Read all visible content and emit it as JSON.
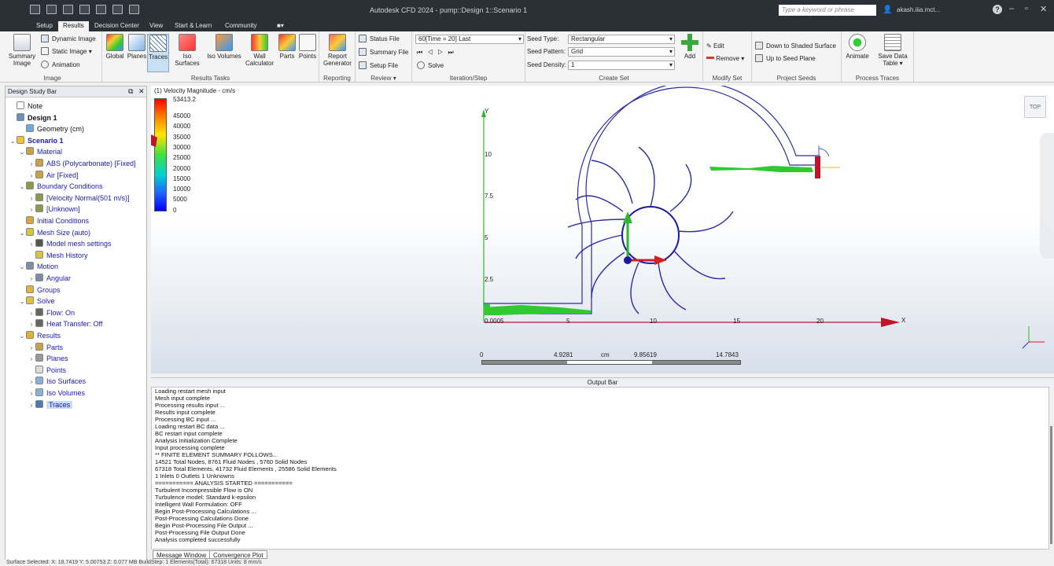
{
  "app": {
    "title": "Autodesk CFD 2024 - pump::Design 1::Scenario 1",
    "search_placeholder": "Type a keyword or phrase",
    "user": "akash.iiia.mct...",
    "help": "?"
  },
  "tabs": [
    "Setup",
    "Results",
    "Decision Center",
    "View",
    "Start & Learn",
    "Community"
  ],
  "ribbon": {
    "image": {
      "summary": "Summary Image",
      "dynamic": "Dynamic Image",
      "static": "Static Image",
      "animation": "Animation",
      "label": "Image"
    },
    "results_tasks": {
      "global": "Global",
      "planes": "Planes",
      "traces": "Traces",
      "iso_surfaces": "Iso Surfaces",
      "iso_volumes": "Iso Volumes",
      "wall_calculator": "Wall Calculator",
      "parts": "Parts",
      "points": "Points",
      "label": "Results Tasks"
    },
    "reporting": {
      "report": "Report Generator",
      "label": "Reporting"
    },
    "review": {
      "status": "Status File",
      "summary": "Summary File",
      "setup": "Setup File",
      "label": "Review"
    },
    "iteration": {
      "value": "60[Time = 20] Last",
      "solve": "Solve",
      "label": "Iteration/Step"
    },
    "create_set": {
      "seed_type_label": "Seed Type:",
      "seed_type": "Rectangular",
      "seed_pattern_label": "Seed Pattern:",
      "seed_pattern": "Grid",
      "seed_density_label": "Seed Density:",
      "seed_density": "1",
      "add": "Add",
      "label": "Create Set"
    },
    "modify_set": {
      "edit": "Edit",
      "remove": "Remove",
      "label": "Modify Set"
    },
    "project_seeds": {
      "down": "Down to Shaded Surface",
      "up": "Up to Seed Plane",
      "label": "Project Seeds"
    },
    "process_traces": {
      "animate": "Animate",
      "save": "Save Data Table",
      "label": "Process Traces"
    }
  },
  "design_bar": {
    "title": "Design Study Bar",
    "items": [
      {
        "label": "Note",
        "indent": 0,
        "arrow": "",
        "style": "dark",
        "color": "#ffffff"
      },
      {
        "label": "Design 1",
        "indent": 0,
        "arrow": "",
        "style": "dark bold",
        "color": "#6c8fbf"
      },
      {
        "label": "Geometry (cm)",
        "indent": 1,
        "arrow": "",
        "style": "dark",
        "color": "#6fa8dc"
      },
      {
        "label": "Scenario 1",
        "indent": 0,
        "arrow": "⌄",
        "style": "bold",
        "color": "#f1c232"
      },
      {
        "label": "Material",
        "indent": 1,
        "arrow": "⌄",
        "style": "",
        "color": "#c8a24a"
      },
      {
        "label": "ABS (Polycarbonate) [Fixed]",
        "indent": 2,
        "arrow": "›",
        "style": "",
        "color": "#c8a24a"
      },
      {
        "label": "Air [Fixed]",
        "indent": 2,
        "arrow": "›",
        "style": "",
        "color": "#c8a24a"
      },
      {
        "label": "Boundary Conditions",
        "indent": 1,
        "arrow": "⌄",
        "style": "",
        "color": "#8a9a4a"
      },
      {
        "label": "[Velocity Normal(501 m/s)]",
        "indent": 2,
        "arrow": "›",
        "style": "",
        "color": "#8a9a4a"
      },
      {
        "label": "[Unknown]",
        "indent": 2,
        "arrow": "›",
        "style": "",
        "color": "#8a9a4a"
      },
      {
        "label": "Initial Conditions",
        "indent": 1,
        "arrow": "",
        "style": "",
        "color": "#d9a441"
      },
      {
        "label": "Mesh Size (auto)",
        "indent": 1,
        "arrow": "⌄",
        "style": "",
        "color": "#d9c441"
      },
      {
        "label": "Model mesh settings",
        "indent": 2,
        "arrow": "›",
        "style": "",
        "color": "#555555"
      },
      {
        "label": "Mesh History",
        "indent": 2,
        "arrow": "",
        "style": "",
        "color": "#d9c441"
      },
      {
        "label": "Motion",
        "indent": 1,
        "arrow": "⌄",
        "style": "",
        "color": "#7a8ea8"
      },
      {
        "label": "Angular",
        "indent": 2,
        "arrow": "›",
        "style": "",
        "color": "#7a8ea8"
      },
      {
        "label": "Groups",
        "indent": 1,
        "arrow": "",
        "style": "",
        "color": "#e0b040"
      },
      {
        "label": "Solve",
        "indent": 1,
        "arrow": "⌄",
        "style": "",
        "color": "#e0c040"
      },
      {
        "label": "Flow: On",
        "indent": 2,
        "arrow": "›",
        "style": "",
        "color": "#666666"
      },
      {
        "label": "Heat Transfer: Off",
        "indent": 2,
        "arrow": "›",
        "style": "",
        "color": "#666666"
      },
      {
        "label": "Results",
        "indent": 1,
        "arrow": "⌄",
        "style": "",
        "color": "#e0b030"
      },
      {
        "label": "Parts",
        "indent": 2,
        "arrow": "›",
        "style": "",
        "color": "#c8a24a"
      },
      {
        "label": "Planes",
        "indent": 2,
        "arrow": "›",
        "style": "",
        "color": "#999999"
      },
      {
        "label": "Points",
        "indent": 2,
        "arrow": "",
        "style": "",
        "color": "#dddddd"
      },
      {
        "label": "Iso Surfaces",
        "indent": 2,
        "arrow": "›",
        "style": "",
        "color": "#8ab0d8"
      },
      {
        "label": "Iso Volumes",
        "indent": 2,
        "arrow": "›",
        "style": "",
        "color": "#8ab0d8"
      },
      {
        "label": "Traces",
        "indent": 2,
        "arrow": "›",
        "style": "sel",
        "color": "#4a7ab0"
      }
    ]
  },
  "viewport": {
    "legend_title": "(1) Velocity Magnitude - cm/s",
    "legend_ticks": [
      "53413.2",
      "45000",
      "40000",
      "35000",
      "30000",
      "25000",
      "20000",
      "15000",
      "10000",
      "5000",
      "0"
    ],
    "axis_y_label": "Y",
    "axis_x_label": "X",
    "y_ticks": [
      "10",
      "7.5",
      "5",
      "2.5"
    ],
    "x_ticks": [
      "0.0005",
      "5",
      "10",
      "15",
      "20"
    ],
    "ruler": [
      "0",
      "4.9281",
      "cm",
      "9.85619",
      "14.7843"
    ],
    "viewcube": "TOP"
  },
  "output": {
    "title": "Output Bar",
    "lines": [
      "Loading restart mesh input",
      "Mesh input complete",
      "Processing results input ...",
      "Results input complete",
      "Processing BC input ...",
      "Loading restart BC data ...",
      "BC restart input complete",
      "Analysis Initialization Complete",
      "Input processing complete",
      "** FINITE ELEMENT SUMMARY FOLLOWS...",
      "14521 Total Nodes,   8761 Fluid Nodes ,   5760 Solid Nodes",
      "67318 Total Elements,  41732 Fluid Elements ,   25586 Solid Elements",
      "1 Inlets   0 Outlets   1 Unknowns",
      "=========== ANALYSIS STARTED ===========",
      "Turbulent Incompressible Flow is ON",
      "Turbulence model: Standard k-epsilon",
      "Intelligent Wall Formulation: OFF",
      "Begin Post-Processing Calculations ...",
      "Post-Processing Calculations Done",
      "Begin Post-Processing File Output ...",
      "Post-Processing File Output Done",
      "Analysis completed successfully"
    ],
    "tabs": [
      "Message Window",
      "Convergence Plot"
    ]
  },
  "status": "Surface  Selected:  X: 18.7419 Y: 5.00753 Z: 0.077 MB  BuildStep: 1 Elements(Total): 67318  Units: 8 mm/s"
}
